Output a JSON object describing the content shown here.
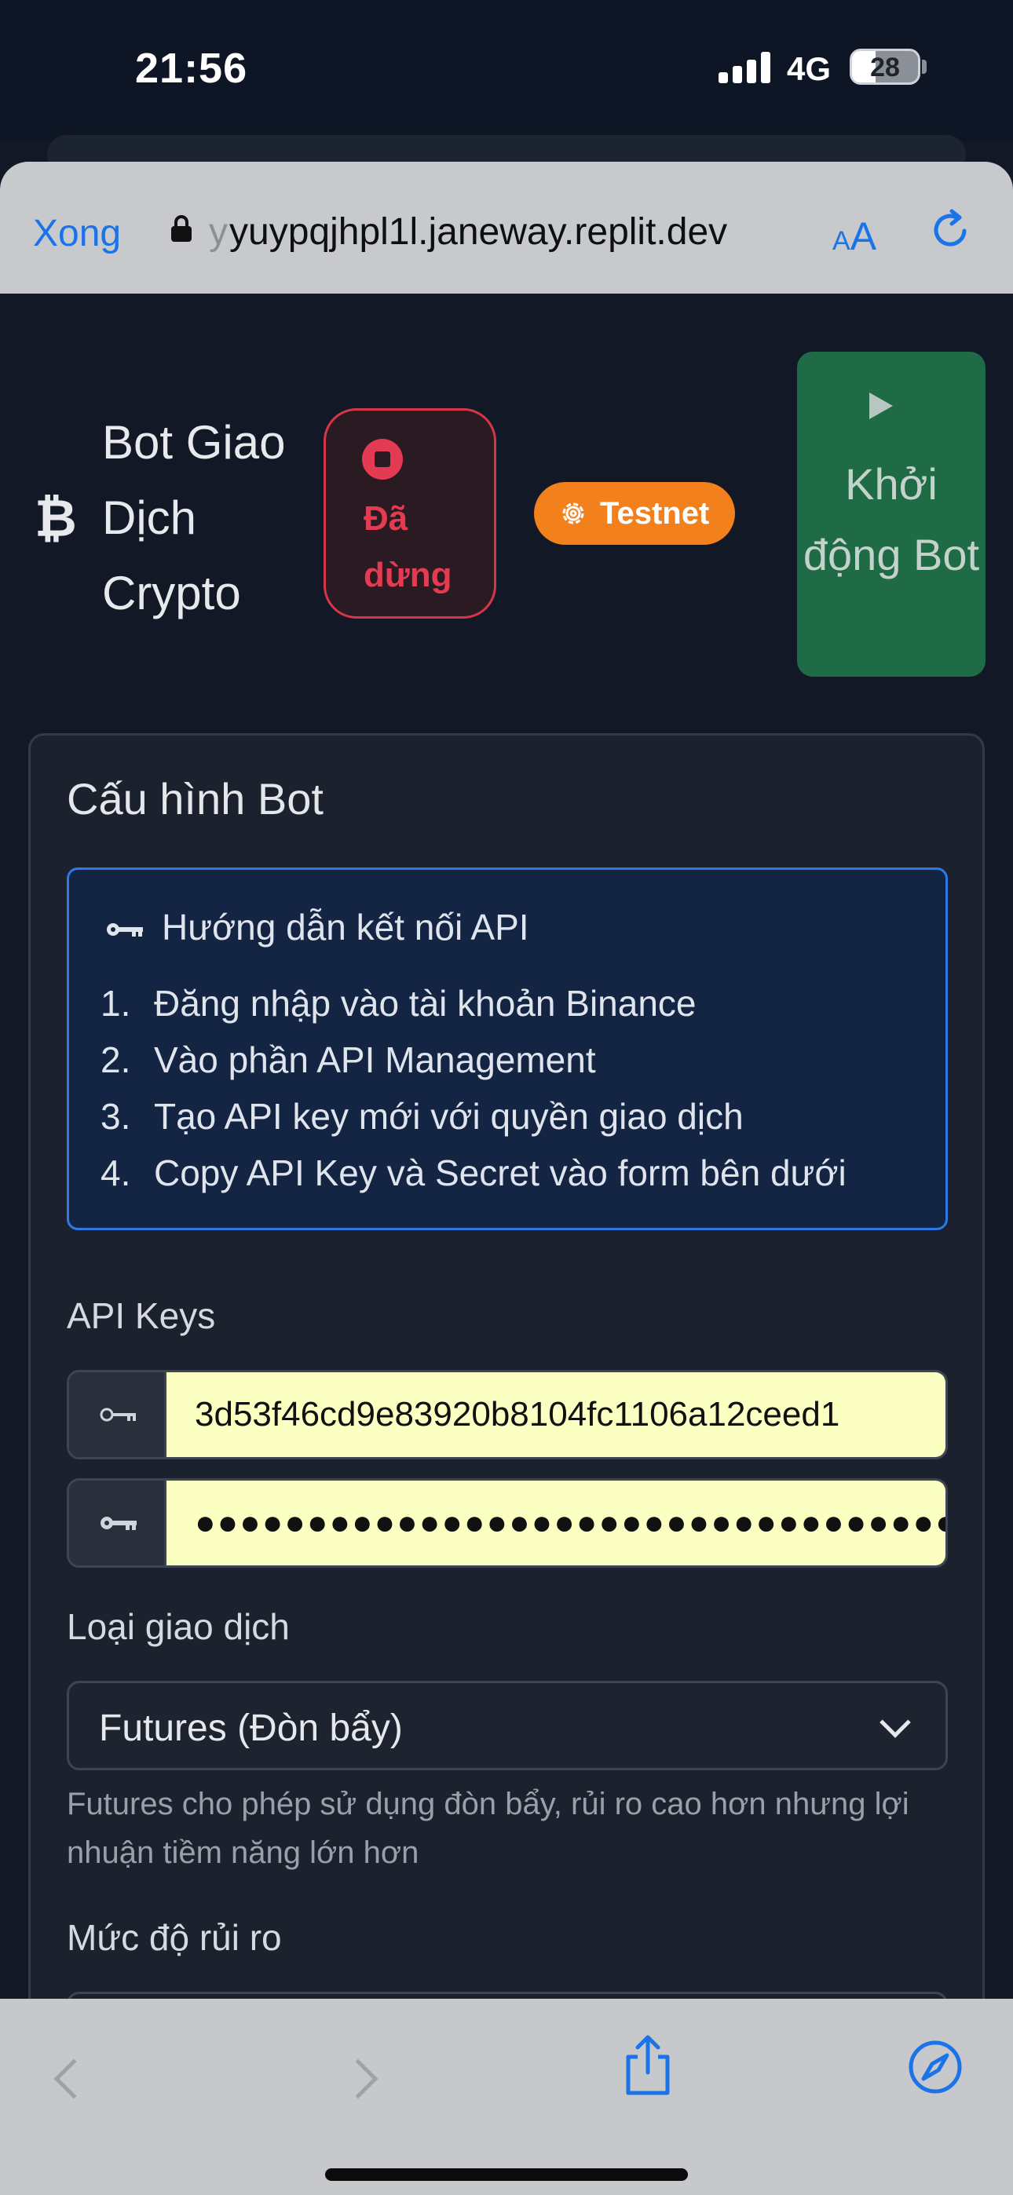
{
  "status_bar": {
    "time": "21:56",
    "network": "4G",
    "battery": "28"
  },
  "browser": {
    "done_label": "Xong",
    "url_hidden_prefix": "y",
    "url": "yuypqjhpl1l.janeway.replit.dev",
    "text_size_label": "AA"
  },
  "header": {
    "title": "Bot Giao Dịch Crypto",
    "status": "Đã dừng",
    "network_badge": "Testnet",
    "start_button": "Khởi động Bot"
  },
  "config": {
    "title": "Cấu hình Bot",
    "guide": {
      "title": "Hướng dẫn kết nối API",
      "steps": [
        {
          "num": "1.",
          "text": "Đăng nhập vào tài khoản Binance"
        },
        {
          "num": "2.",
          "text": "Vào phần API Management"
        },
        {
          "num": "3.",
          "text": "Tạo API key mới với quyền giao dịch"
        },
        {
          "num": "4.",
          "text": "Copy API Key và Secret vào form bên dưới"
        }
      ]
    },
    "api_keys_label": "API Keys",
    "api_key_value": "3d53f46cd9e83920b8104fc1106a12ceed1",
    "api_secret_value": "●●●●●●●●●●●●●●●●●●●●●●●●●●●●●●●●●●●",
    "trade_type_label": "Loại giao dịch",
    "trade_type_value": "Futures (Đòn bẩy)",
    "trade_type_help": "Futures cho phép sử dụng đòn bẩy, rủi ro cao hơn nhưng lợi nhuận tiềm năng lớn hơn",
    "risk_label": "Mức độ rủi ro"
  },
  "colors": {
    "accent_blue": "#1a74e8",
    "danger": "#e43b52",
    "warning": "#f2801c",
    "success": "#1e6b45"
  }
}
